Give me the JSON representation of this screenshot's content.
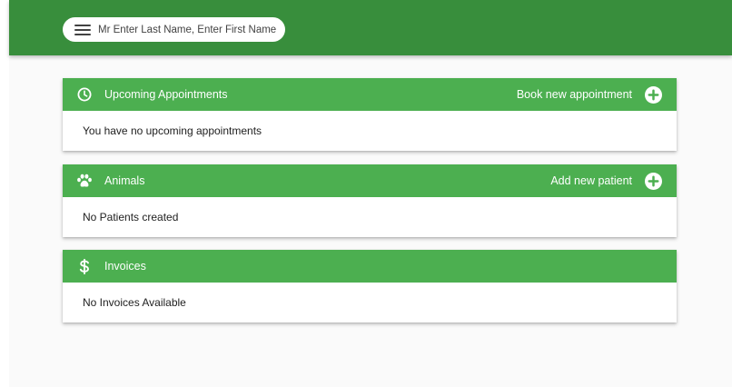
{
  "header": {
    "user_name": "Mr Enter Last Name, Enter First Name"
  },
  "sections": {
    "appointments": {
      "title": "Upcoming Appointments",
      "icon": "clock-icon",
      "action_label": "Book new appointment",
      "empty_text": "You have no upcoming appointments"
    },
    "animals": {
      "title": "Animals",
      "icon": "paw-icon",
      "action_label": "Add new patient",
      "empty_text": "No Patients created"
    },
    "invoices": {
      "title": "Invoices",
      "icon": "dollar-icon",
      "empty_text": "No Invoices Available"
    }
  },
  "colors": {
    "topbar": "#388e3c",
    "card_header": "#4caf50",
    "background": "#fafafa"
  }
}
